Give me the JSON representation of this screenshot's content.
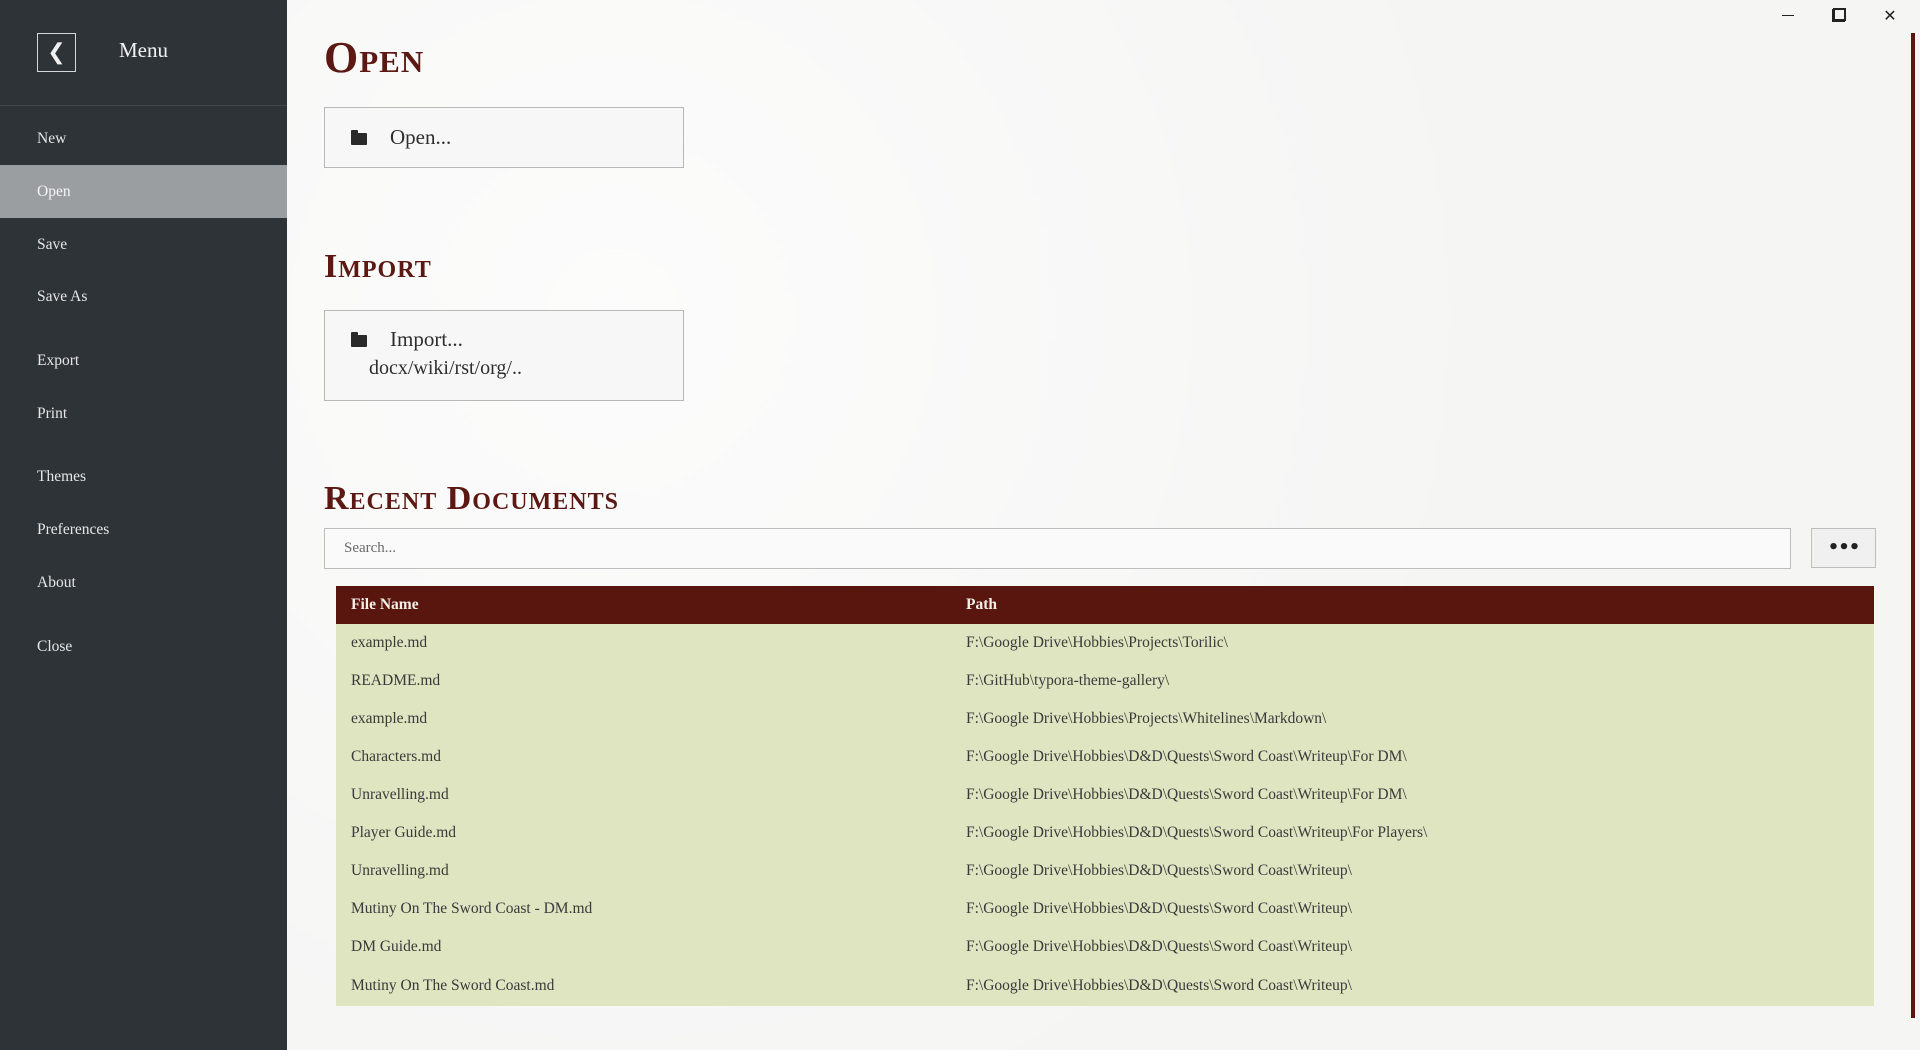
{
  "sidebar": {
    "back_icon": "chevron-left-icon",
    "back_glyph": "❮",
    "title": "Menu",
    "items": [
      {
        "label": "New",
        "active": false
      },
      {
        "label": "Open",
        "active": true
      },
      {
        "label": "Save",
        "active": false
      },
      {
        "label": "Save As",
        "active": false
      },
      {
        "label": "Export",
        "active": false
      },
      {
        "label": "Print",
        "active": false
      },
      {
        "label": "Themes",
        "active": false
      },
      {
        "label": "Preferences",
        "active": false
      },
      {
        "label": "About",
        "active": false
      },
      {
        "label": "Close",
        "active": false
      }
    ]
  },
  "open_section": {
    "title": "Open",
    "button_label": "Open...",
    "icon": "folder-icon"
  },
  "import_section": {
    "title": "Import",
    "button_label": "Import...",
    "button_sublabel": "docx/wiki/rst/org/..",
    "icon": "folder-icon"
  },
  "recent_section": {
    "title": "Recent Documents",
    "search_placeholder": "Search...",
    "more_label": "•••",
    "columns": [
      "File Name",
      "Path"
    ],
    "rows": [
      [
        "example.md",
        "F:\\Google Drive\\Hobbies\\Projects\\Torilic\\"
      ],
      [
        "README.md",
        "F:\\GitHub\\typora-theme-gallery\\"
      ],
      [
        "example.md",
        "F:\\Google Drive\\Hobbies\\Projects\\Whitelines\\Markdown\\"
      ],
      [
        "Characters.md",
        "F:\\Google Drive\\Hobbies\\D&D\\Quests\\Sword Coast\\Writeup\\For DM\\"
      ],
      [
        "Unravelling.md",
        "F:\\Google Drive\\Hobbies\\D&D\\Quests\\Sword Coast\\Writeup\\For DM\\"
      ],
      [
        "Player Guide.md",
        "F:\\Google Drive\\Hobbies\\D&D\\Quests\\Sword Coast\\Writeup\\For Players\\"
      ],
      [
        "Unravelling.md",
        "F:\\Google Drive\\Hobbies\\D&D\\Quests\\Sword Coast\\Writeup\\"
      ],
      [
        "Mutiny On The Sword Coast - DM.md",
        "F:\\Google Drive\\Hobbies\\D&D\\Quests\\Sword Coast\\Writeup\\"
      ],
      [
        "DM Guide.md",
        "F:\\Google Drive\\Hobbies\\D&D\\Quests\\Sword Coast\\Writeup\\"
      ],
      [
        "Mutiny On The Sword Coast.md",
        "F:\\Google Drive\\Hobbies\\D&D\\Quests\\Sword Coast\\Writeup\\"
      ]
    ]
  },
  "window_controls": {
    "minimize_icon": "minimize-icon",
    "maximize_icon": "restore-icon",
    "close_icon": "close-icon",
    "close_glyph": "✕"
  },
  "colors": {
    "sidebar_bg": "#2e3338",
    "active_item_bg": "#9a9ea1",
    "accent": "#5c1913",
    "table_header_bg": "#59160f",
    "table_row_bg": "#dfe4c1"
  }
}
